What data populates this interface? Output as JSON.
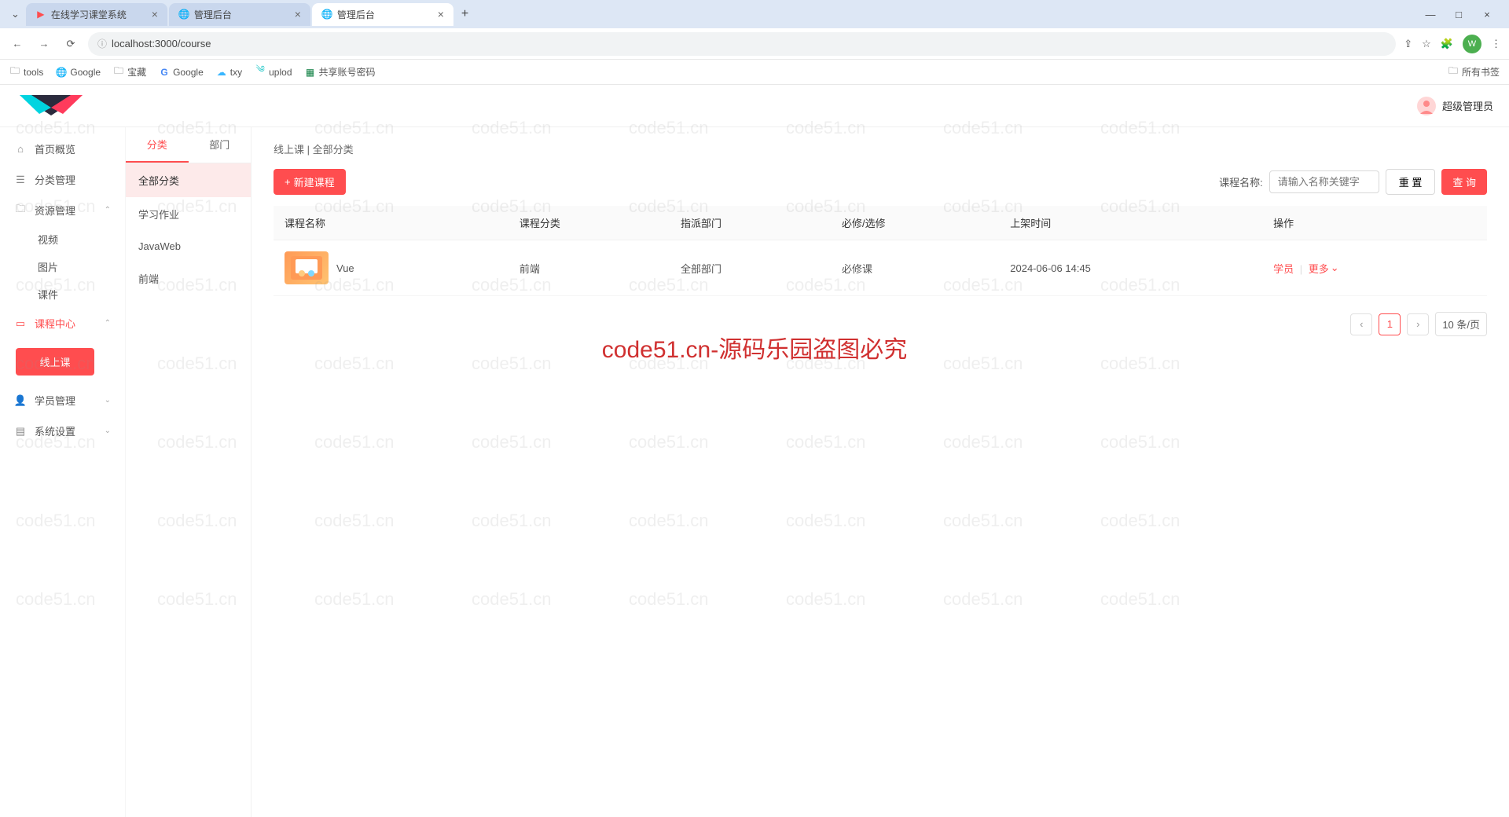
{
  "browser": {
    "tabs": [
      {
        "title": "在线学习课堂系统",
        "favicon": "play-red"
      },
      {
        "title": "管理后台",
        "favicon": "globe"
      },
      {
        "title": "管理后台",
        "favicon": "globe"
      }
    ],
    "active_tab_index": 2,
    "win": {
      "minimize": "—",
      "maximize": "□",
      "close": "×"
    },
    "url": "localhost:3000/course",
    "url_icon": "info",
    "nav": {
      "back": "←",
      "forward": "→",
      "reload": "⟳"
    },
    "right_icons": {
      "share": "⇧",
      "star": "☆",
      "ext": "⧩",
      "menu": "⋮"
    },
    "avatar_letter": "W",
    "bookmarks": [
      {
        "icon": "folder",
        "label": "tools"
      },
      {
        "icon": "globe",
        "label": "Google"
      },
      {
        "icon": "folder",
        "label": "宝藏"
      },
      {
        "icon": "g-color",
        "label": "Google"
      },
      {
        "icon": "cloud",
        "label": "txy"
      },
      {
        "icon": "swirl",
        "label": "uplod"
      },
      {
        "icon": "grid-green",
        "label": "共享账号密码"
      }
    ],
    "bookmark_right": {
      "icon": "folder",
      "label": "所有书签"
    }
  },
  "app": {
    "user_label": "超级管理员",
    "sidebar": [
      {
        "icon": "home",
        "label": "首页概览",
        "type": "item"
      },
      {
        "icon": "layers",
        "label": "分类管理",
        "type": "item"
      },
      {
        "icon": "folder",
        "label": "资源管理",
        "type": "expand",
        "open": true,
        "children": [
          "视频",
          "图片",
          "课件"
        ]
      },
      {
        "icon": "chat",
        "label": "课程中心",
        "type": "expand",
        "open": true,
        "active": true,
        "button": "线上课"
      },
      {
        "icon": "user",
        "label": "学员管理",
        "type": "expand"
      },
      {
        "icon": "settings",
        "label": "系统设置",
        "type": "expand"
      }
    ],
    "subpanel": {
      "tabs": [
        {
          "label": "分类",
          "active": true
        },
        {
          "label": "部门"
        }
      ],
      "categories": [
        {
          "label": "全部分类",
          "active": true
        },
        {
          "label": "学习作业"
        },
        {
          "label": "JavaWeb"
        },
        {
          "label": "前端"
        }
      ]
    },
    "breadcrumb": "线上课 | 全部分类",
    "toolbar": {
      "new_course": "新建课程",
      "search_label": "课程名称:",
      "search_placeholder": "请输入名称关键字",
      "reset": "重 置",
      "query": "查 询"
    },
    "table": {
      "columns": [
        "课程名称",
        "课程分类",
        "指派部门",
        "必修/选修",
        "上架时间",
        "操作"
      ],
      "rows": [
        {
          "name": "Vue",
          "category": "前端",
          "dept": "全部部门",
          "required": "必修课",
          "time": "2024-06-06 14:45",
          "actions": {
            "student": "学员",
            "more": "更多"
          }
        }
      ]
    },
    "pagination": {
      "prev": "‹",
      "current": "1",
      "next": "›",
      "size": "10 条/页"
    }
  },
  "watermark": {
    "main": "code51.cn-源码乐园盗图必究",
    "small": "code51.cn"
  }
}
